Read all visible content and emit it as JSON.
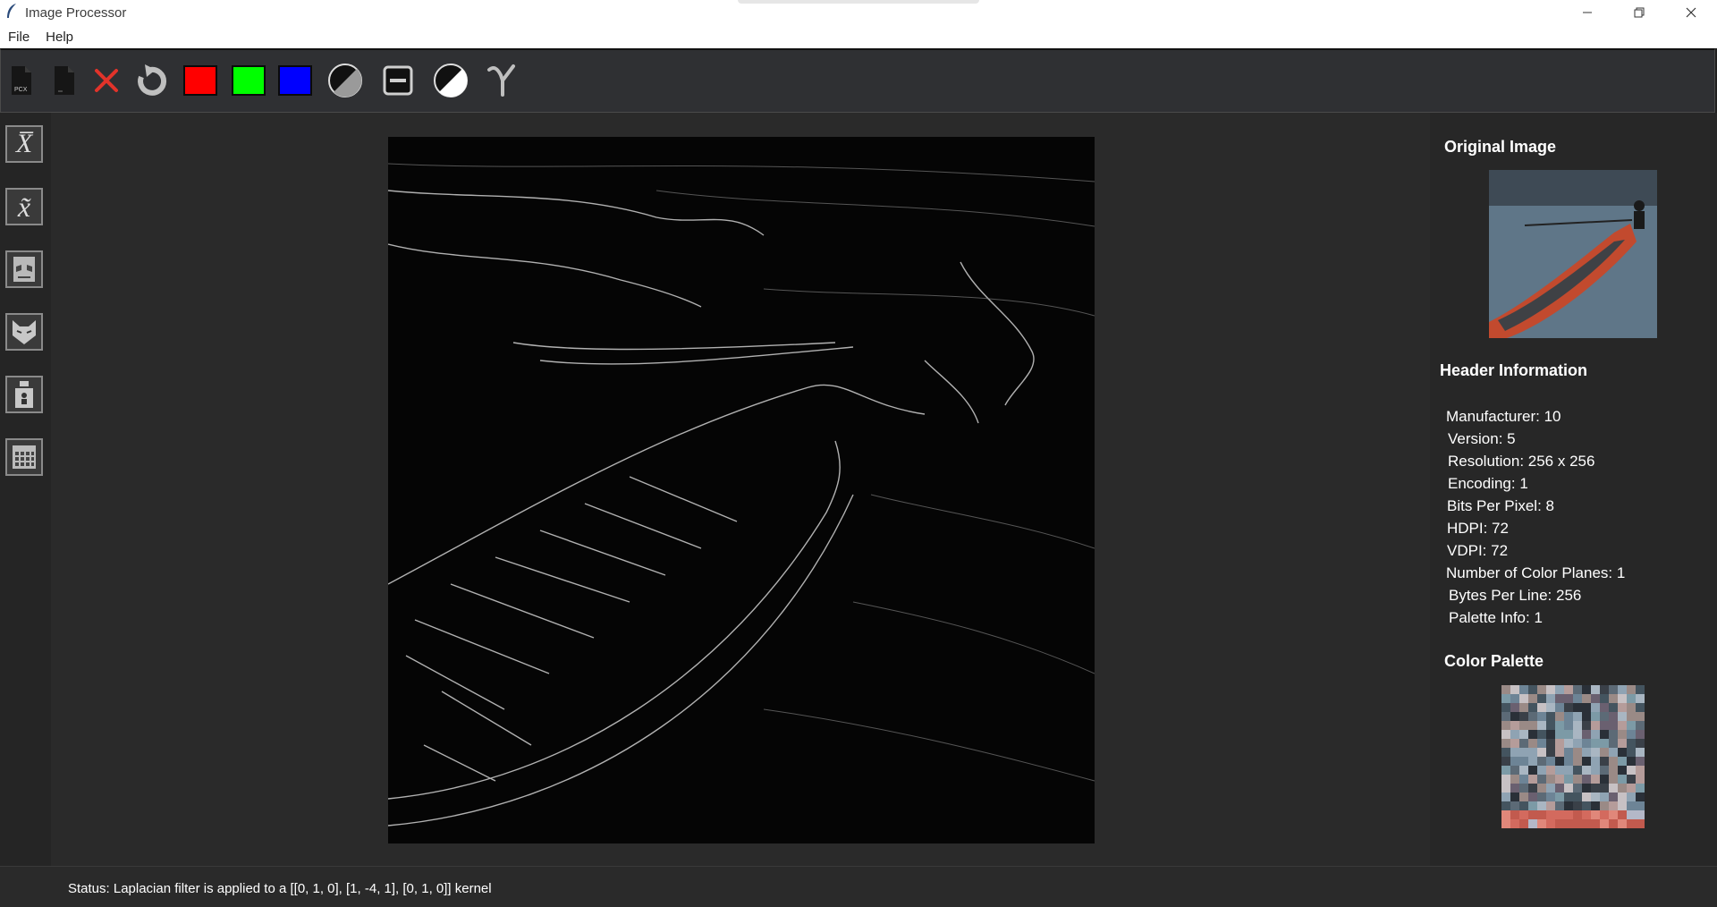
{
  "window": {
    "title": "Image Processor"
  },
  "menu": {
    "file": "File",
    "help": "Help"
  },
  "toolbar": {
    "items": [
      {
        "name": "open-pcx-icon",
        "label": "PCX"
      },
      {
        "name": "blank-file-icon"
      },
      {
        "name": "close-icon"
      },
      {
        "name": "rotate-icon"
      },
      {
        "name": "red-channel-button",
        "color": "#ff0000"
      },
      {
        "name": "green-channel-button",
        "color": "#00ff00"
      },
      {
        "name": "blue-channel-button",
        "color": "#0000ff"
      },
      {
        "name": "grayscale-icon"
      },
      {
        "name": "threshold-icon"
      },
      {
        "name": "negative-icon"
      },
      {
        "name": "gamma-icon"
      }
    ]
  },
  "sidebar": {
    "items": [
      {
        "name": "mean-filter-icon",
        "symbol": "X̅"
      },
      {
        "name": "median-filter-icon",
        "symbol": "x̃"
      },
      {
        "name": "sharpen-icon"
      },
      {
        "name": "cat-icon"
      },
      {
        "name": "lift-icon"
      },
      {
        "name": "grid-icon"
      }
    ]
  },
  "right_panel": {
    "original_image_title": "Original Image",
    "header_title": "Header Information",
    "header_lines": [
      "Manufacturer: 10",
      "Version: 5",
      "Resolution: 256 x 256",
      "Encoding: 1",
      "Bits Per Pixel: 8",
      "HDPI: 72",
      "VDPI: 72",
      "Number of Color Planes: 1",
      "Bytes Per Line: 256",
      "Palette Info: 1"
    ],
    "palette_title": "Color Palette"
  },
  "status": {
    "text": "Status: Laplacian filter is applied to a [[0, 1, 0], [1, -4, 1], [0, 1, 0]] kernel"
  }
}
